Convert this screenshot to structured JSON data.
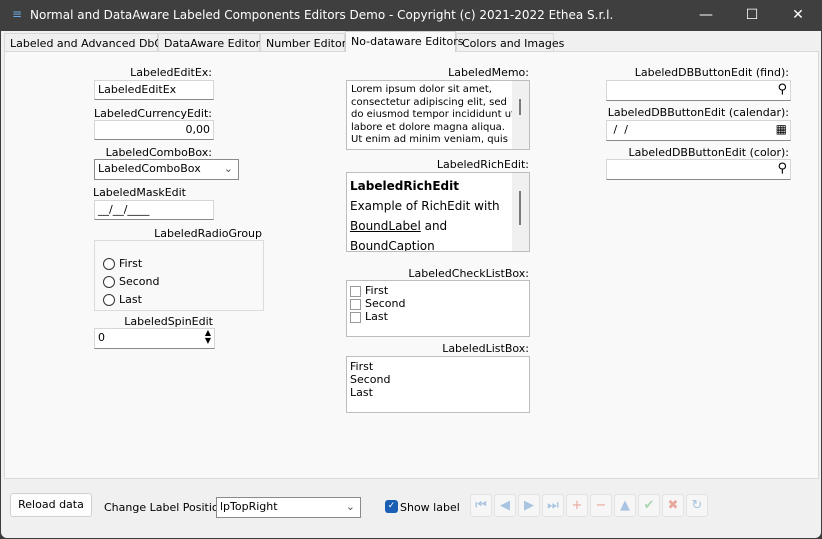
{
  "window": {
    "title": "Normal and DataAware Labeled Components Editors Demo - Copyright (c) 2021-2022 Ethea S.r.l.",
    "minimize": "—",
    "maximize": "☐",
    "close": "✕"
  },
  "tabs": [
    {
      "label": "Labeled and Advanced DbGrid"
    },
    {
      "label": "DataAware Editors"
    },
    {
      "label": "Number Editors"
    },
    {
      "label": "No-dataware Editors",
      "active": true
    },
    {
      "label": "Colors and Images"
    }
  ],
  "left": {
    "edit_ex": {
      "label": "LabeledEditEx:",
      "value": "LabeledEditEx"
    },
    "currency": {
      "label": "LabeledCurrencyEdit:",
      "value": "0,00"
    },
    "combo": {
      "label": "LabeledComboBox:",
      "value": "LabeledComboBox"
    },
    "mask": {
      "label": "LabeledMaskEdit",
      "value": "__/__/____"
    },
    "radio": {
      "label": "LabeledRadioGroup",
      "items": [
        "First",
        "Second",
        "Last"
      ]
    },
    "spin": {
      "label": "LabeledSpinEdit",
      "value": "0"
    }
  },
  "middle": {
    "memo": {
      "label": "LabeledMemo:",
      "lines": [
        "Lorem ipsum dolor sit amet,",
        "consectetur adipiscing elit, sed",
        "do eiusmod tempor incididunt ut",
        "labore et dolore magna aliqua.",
        "Ut enim ad minim veniam, quis"
      ]
    },
    "rich": {
      "label": "LabeledRichEdit:",
      "title": "LabeledRichEdit",
      "line1": "Example of RichEdit with",
      "link": "BoundLabel",
      "and": " and",
      "line3": "BoundCaption"
    },
    "checklist": {
      "label": "LabeledCheckListBox:",
      "items": [
        "First",
        "Second",
        "Last"
      ]
    },
    "listbox": {
      "label": "LabeledListBox:",
      "items": [
        "First",
        "Second",
        "Last"
      ]
    }
  },
  "right": {
    "find": {
      "label": "LabeledDBButtonEdit (find):",
      "value": "",
      "icon": "search-icon"
    },
    "calendar": {
      "label": "LabeledDBButtonEdit (calendar):",
      "value": " /  /",
      "icon": "calendar-icon"
    },
    "color": {
      "label": "LabeledDBButtonEdit (color):",
      "value": "",
      "icon": "search-icon"
    }
  },
  "bottom": {
    "reload": "Reload data",
    "position_label": "Change Label Position:",
    "position_value": "lpTopRight",
    "show_label": "Show label",
    "show_label_checked": true,
    "nav": [
      {
        "name": "first",
        "glyph": "⏮",
        "color": "#a8c4e0"
      },
      {
        "name": "prior",
        "glyph": "◀",
        "color": "#a8c4e0"
      },
      {
        "name": "next",
        "glyph": "▶",
        "color": "#a8c4e0"
      },
      {
        "name": "last",
        "glyph": "⏭",
        "color": "#a8c4e0"
      },
      {
        "name": "insert",
        "glyph": "+",
        "color": "#e8a89c"
      },
      {
        "name": "delete",
        "glyph": "−",
        "color": "#e8a89c"
      },
      {
        "name": "edit",
        "glyph": "▲",
        "color": "#a8c4e0"
      },
      {
        "name": "post",
        "glyph": "✔",
        "color": "#a8d8b0"
      },
      {
        "name": "cancel",
        "glyph": "✖",
        "color": "#e8a89c"
      },
      {
        "name": "refresh",
        "glyph": "↻",
        "color": "#a8c4e0"
      }
    ]
  }
}
